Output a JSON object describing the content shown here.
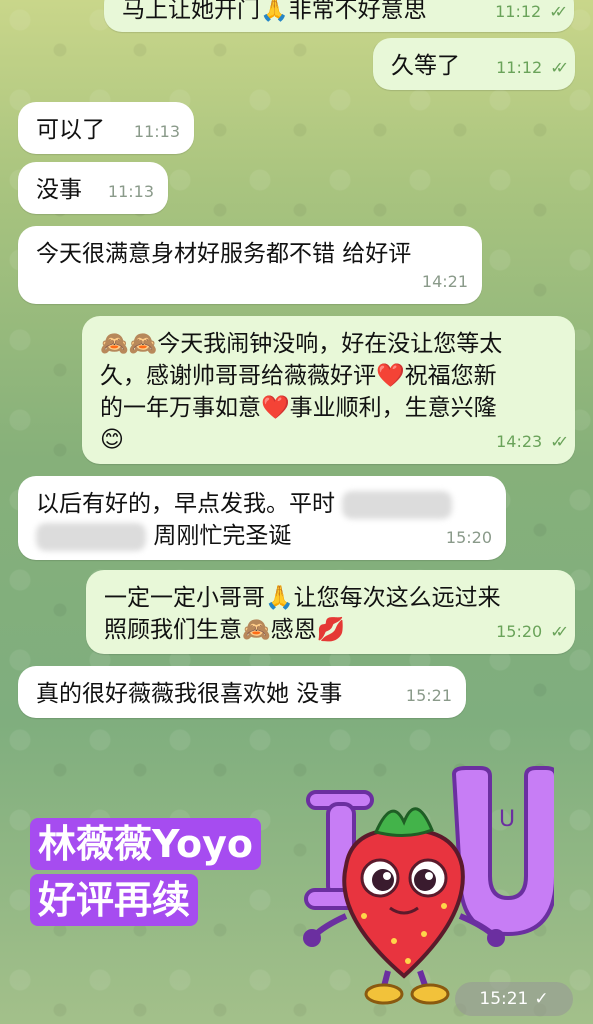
{
  "messages": {
    "m0": {
      "text": "马上让她开门🙏非常不好意思",
      "time": "11:12"
    },
    "m1": {
      "text": "久等了",
      "time": "11:12"
    },
    "m2": {
      "text": "可以了",
      "time": "11:13"
    },
    "m3": {
      "text": "没事",
      "time": "11:13"
    },
    "m4": {
      "text": "今天很满意身材好服务都不错 给好评",
      "time": "14:21"
    },
    "m5": {
      "line1": "🙈🙈今天我闹钟没响，好在没让您等太",
      "line2": "久，感谢帅哥哥给薇薇好评❤️祝福您新",
      "line3": "的一年万事如意❤️事业顺利，生意兴隆",
      "line4": "😊",
      "time": "14:23"
    },
    "m6": {
      "line1": "以后有好的，早点发我。平时",
      "line2": "周刚忙完圣诞",
      "time": "15:20"
    },
    "m7": {
      "line1": "一定一定小哥哥🙏让您每次这么远过来",
      "line2": "照顾我们生意🙈感恩💋",
      "time": "15:20"
    },
    "m8": {
      "text": "真的很好薇薇我很喜欢她 没事",
      "time": "15:21"
    }
  },
  "promo": {
    "line1": "林薇薇Yoyo",
    "line2": "好评再续"
  },
  "sticker": {
    "time": "15:21",
    "letters_left": "I",
    "letters_right": "U"
  },
  "icons": {
    "read": "double-check-icon",
    "single": "single-check-icon"
  }
}
